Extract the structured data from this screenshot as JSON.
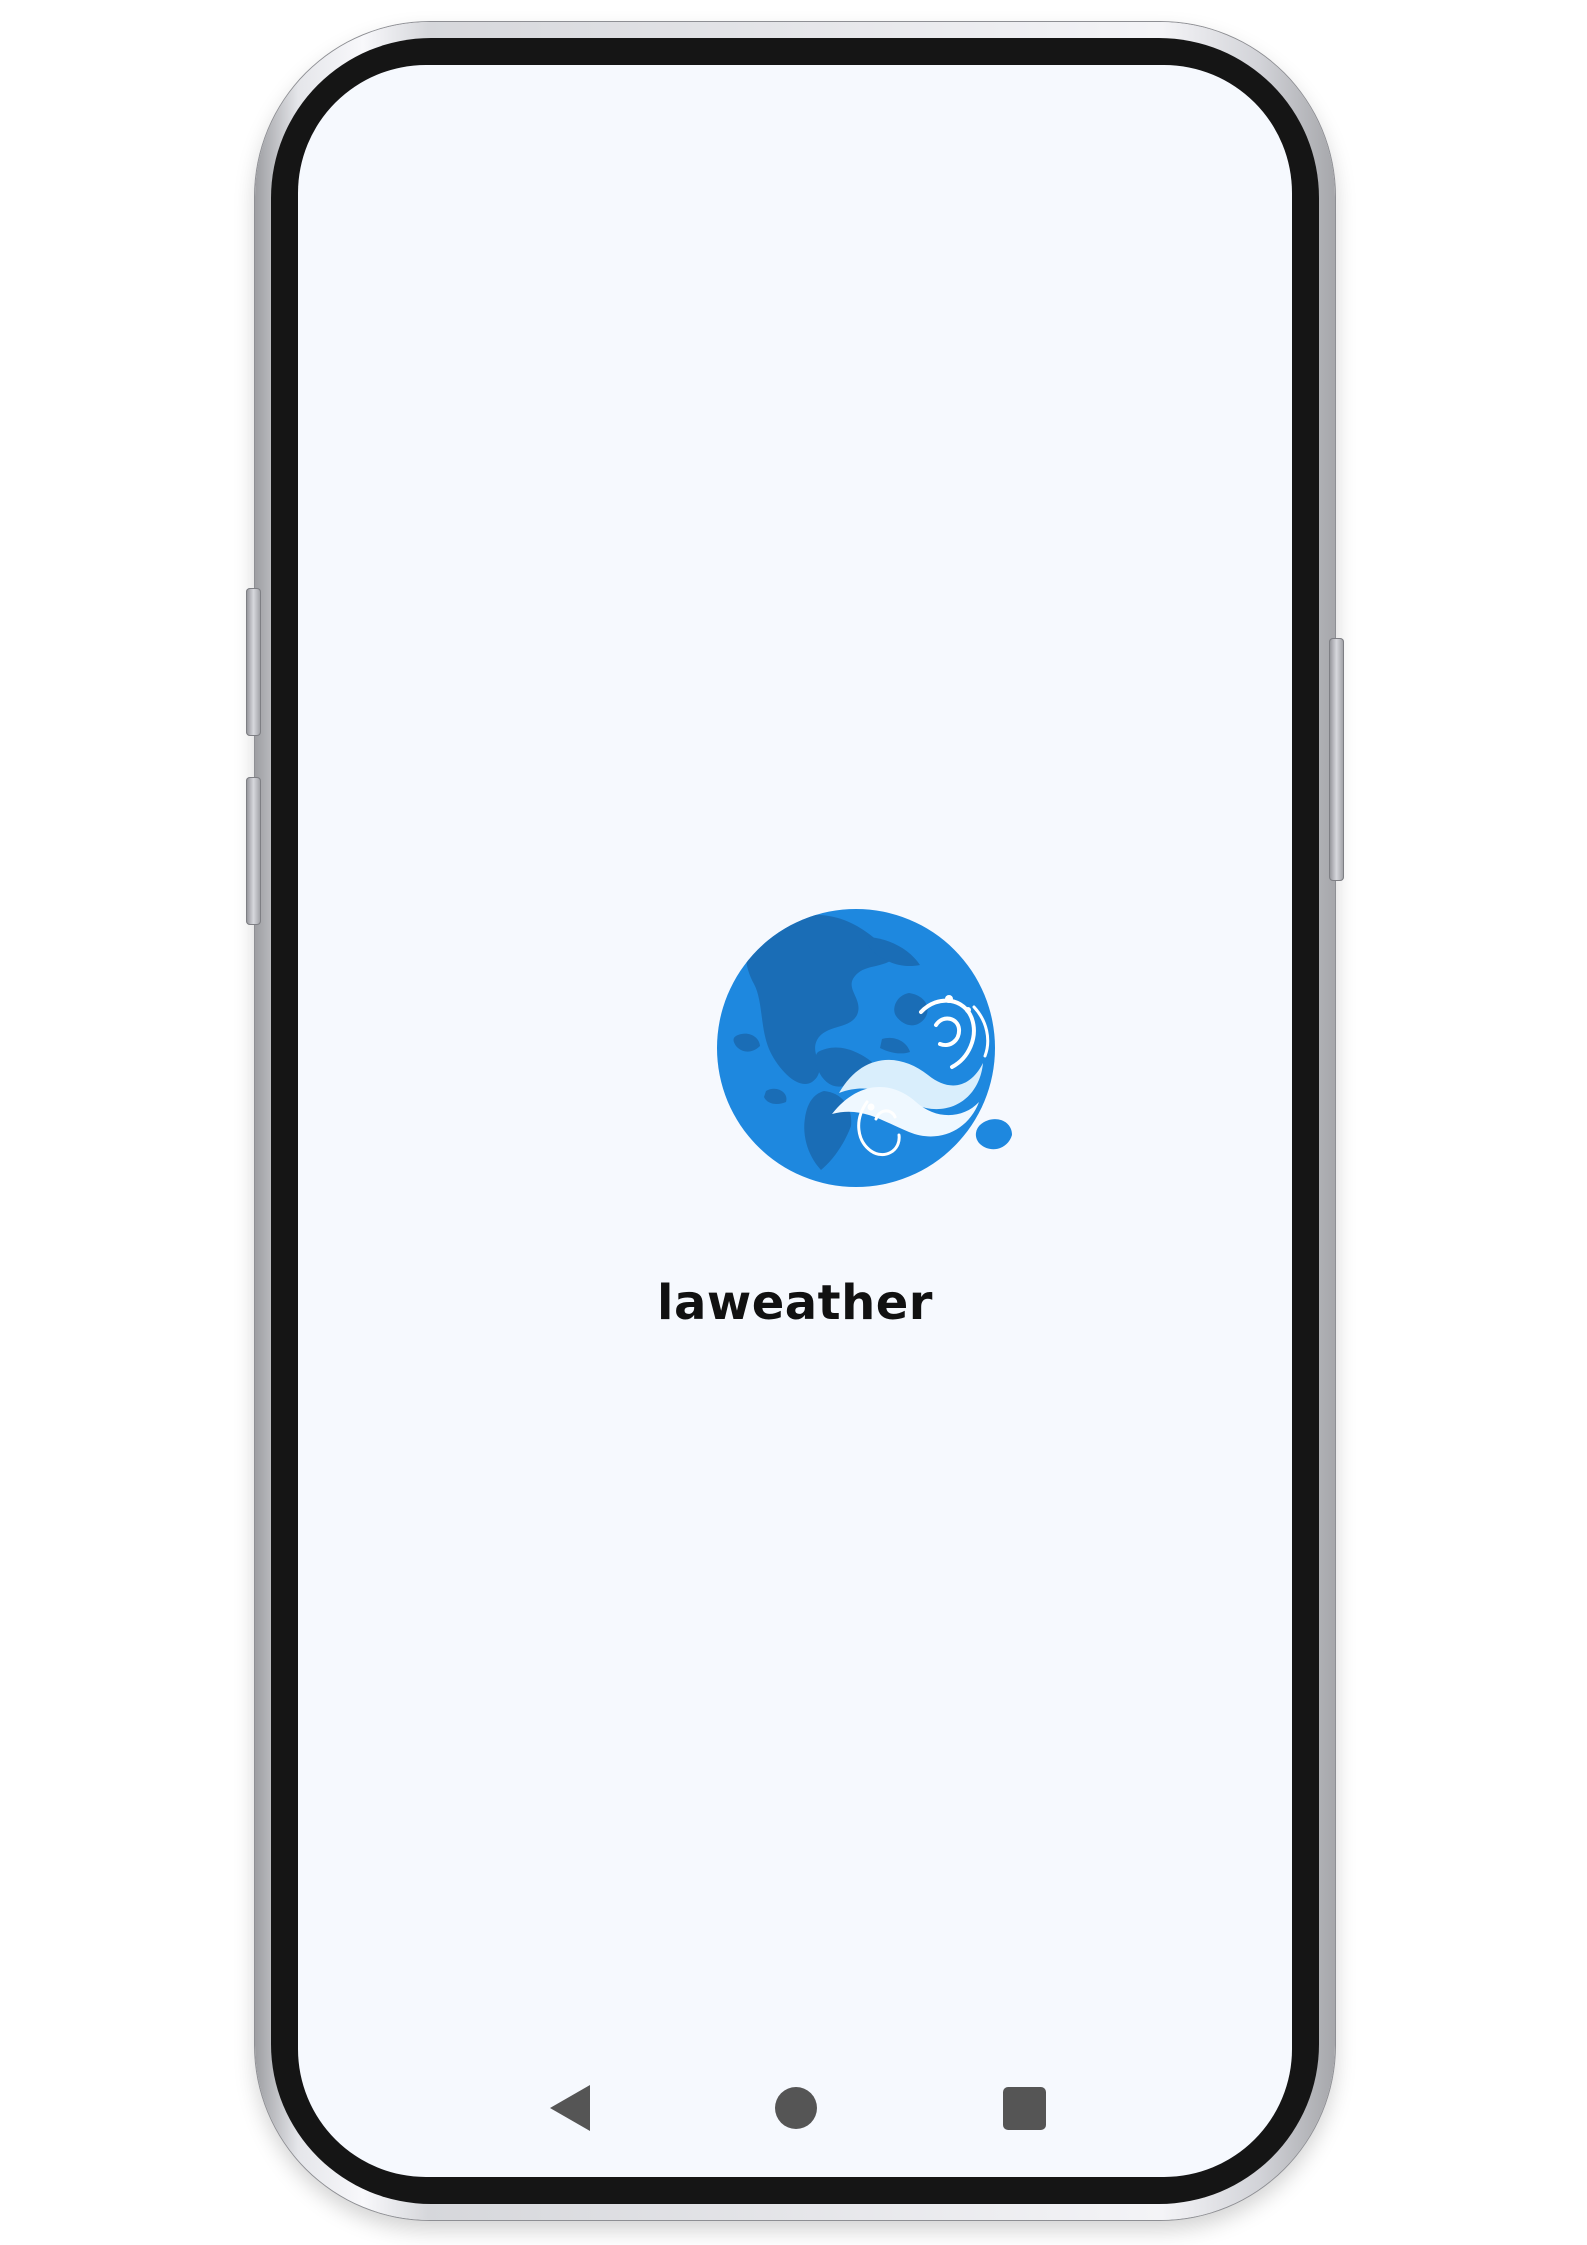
{
  "app": {
    "name": "laweather"
  },
  "brand": {
    "accent": "#1e88df",
    "dark_accent": "#1a6db6",
    "light_accent": "#d9eefc",
    "screen_background": "#f6f9fe",
    "text_color": "#111111"
  },
  "splash": {
    "logo_icon": "globe-weather-logo-icon"
  },
  "navigation": {
    "back_icon": "back-triangle-icon",
    "home_icon": "home-circle-icon",
    "recents_icon": "recents-square-icon",
    "icon_color": "#555555"
  }
}
